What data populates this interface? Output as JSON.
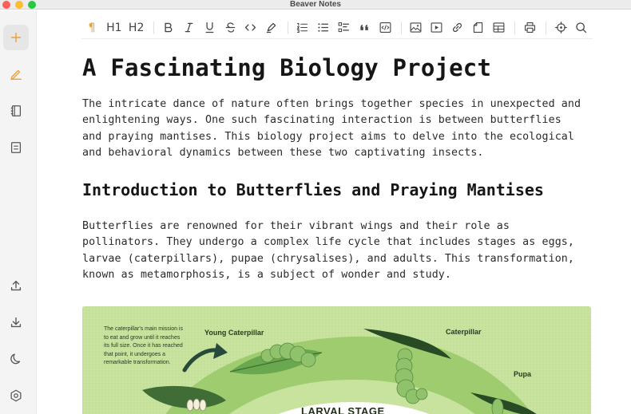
{
  "window": {
    "title": "Beaver Notes"
  },
  "sidebar": {
    "items": [
      {
        "name": "add-note",
        "icon": "plus-icon"
      },
      {
        "name": "edit",
        "icon": "pencil-icon"
      },
      {
        "name": "notebook",
        "icon": "book-icon"
      },
      {
        "name": "archive",
        "icon": "archive-icon"
      },
      {
        "name": "export",
        "icon": "upload-icon"
      },
      {
        "name": "import",
        "icon": "download-icon"
      },
      {
        "name": "dark-mode",
        "icon": "moon-icon"
      },
      {
        "name": "settings",
        "icon": "gear-icon"
      }
    ],
    "accent_color": "#e9a23b"
  },
  "toolbar": {
    "paragraph_label": "¶",
    "h1_label": "H1",
    "h2_label": "H2",
    "icons": [
      "bold-icon",
      "italic-icon",
      "underline-icon",
      "strikethrough-icon",
      "inline-code-icon",
      "highlighter-icon",
      "ordered-list-icon",
      "bullet-list-icon",
      "checklist-icon",
      "quote-icon",
      "code-block-icon",
      "image-icon",
      "video-icon",
      "link-icon",
      "file-icon",
      "table-icon",
      "print-icon",
      "focus-icon",
      "search-icon"
    ]
  },
  "document": {
    "title": "A Fascinating Biology Project",
    "intro_lines": [
      "The intricate dance of nature often brings together species in unexpected and",
      "enlightening ways. One such fascinating interaction is between butterflies",
      "and praying mantises. This biology project aims to delve into the ecological",
      "and behavioral dynamics between these two captivating insects."
    ],
    "section_heading": "Introduction to Butterflies and Praying Mantises",
    "section_lines": [
      "Butterflies are renowned for their vibrant wings and their role as",
      "pollinators. They undergo a complex life cycle that includes stages as eggs,",
      "larvae (caterpillars), pupae (chrysalises), and adults. This transformation,",
      "known as metamorphosis, is a subject of wonder and study."
    ]
  },
  "figure": {
    "note_lines": [
      "The caterpillar's main mission is",
      "to eat and grow until it reaches",
      "its full size. Once it has reached",
      "that point, it undergoes a",
      "remarkable transformation."
    ],
    "label_young": "Young Caterpillar",
    "label_caterpillar": "Caterpillar",
    "label_pupa": "Pupa",
    "stage_label": "LARVAL STAGE"
  }
}
